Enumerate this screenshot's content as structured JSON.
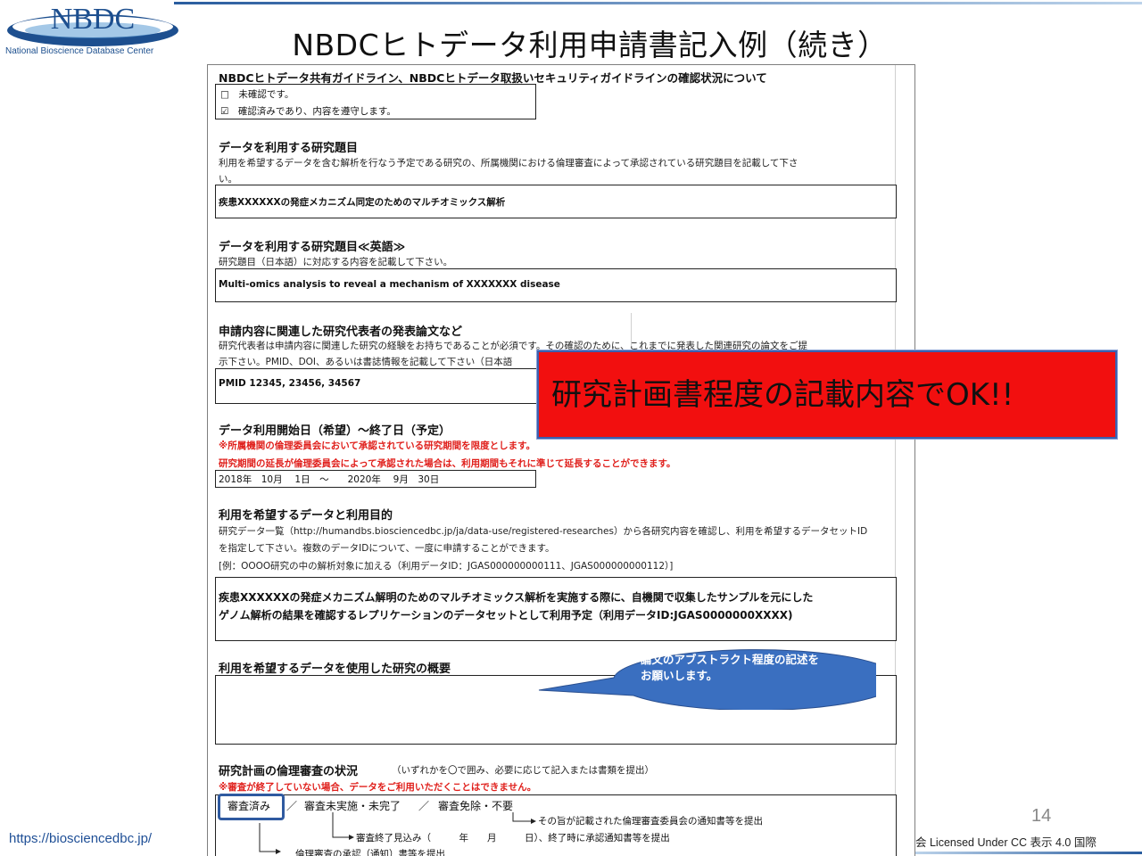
{
  "logo": {
    "text": "NBDC",
    "subtitle": "National Bioscience Database Center"
  },
  "slide": {
    "title": "NBDCヒトデータ利用申請書記入例（続き）",
    "page_number": "14",
    "url": "https://biosciencedbc.jp/",
    "license": "会 Licensed Under CC 表示 4.0 国際"
  },
  "form": {
    "guideline": {
      "heading": "NBDCヒトデータ共有ガイドライン、NBDCヒトデータ取扱いセキュリティガイドラインの確認状況について",
      "opt_unchecked": "□　未確認です。",
      "opt_checked": "☑　確認済みであり、内容を遵守します。"
    },
    "title_jp": {
      "heading": "データを利用する研究題目",
      "desc_line1": "利用を希望するデータを含む解析を行なう予定である研究の、所属機関における倫理審査によって承認されている研究題目を記載して下さ",
      "desc_line2": "い。",
      "value": "疾患XXXXXXの発症メカニズム同定のためのマルチオミックス解析"
    },
    "title_en": {
      "heading": "データを利用する研究題目≪英語≫",
      "desc": "研究題目（日本語）に対応する内容を記載して下さい。",
      "value": "Multi-omics analysis to reveal a mechanism of XXXXXXX disease"
    },
    "papers": {
      "heading": "申請内容に関連した研究代表者の発表論文など",
      "desc_line1": "研究代表者は申請内容に関連した研究の経験をお持ちであることが必須です。その確認のために、これまでに発表した関連研究の論文をご提",
      "desc_line2": "示下さい。PMID、DOI、あるいは書誌情報を記載して下さい（日本語",
      "value": "PMID 12345, 23456, 34567"
    },
    "period": {
      "heading": "データ利用開始日（希望）～終了日（予定）",
      "note1": "※所属機関の倫理委員会において承認されている研究期間を限度とします。",
      "note2": "研究期間の延長が倫理委員会によって承認された場合は、利用期間もそれに準じて延長することができます。",
      "value": "2018年　10月　 1日　～　　2020年　 9月　30日"
    },
    "data_purpose": {
      "heading": "利用を希望するデータと利用目的",
      "desc_line1": "研究データ一覧（http://humandbs.biosciencedbc.jp/ja/data-use/registered-researches）から各研究内容を確認し、利用を希望するデータセットID",
      "desc_line2": "を指定して下さい。複数のデータIDについて、一度に申請することができます。",
      "example": "[例：OOOO研究の中の解析対象に加える（利用データID：JGAS000000000111、JGAS000000000112）]",
      "value_line1": "疾患XXXXXXの発症メカニズム解明のためのマルチオミックス解析を実施する際に、自機関で収集したサンプルを元にした",
      "value_line2": "ゲノム解析の結果を確認するレプリケーションのデータセットとして利用予定（利用データID:JGAS0000000XXXX)"
    },
    "summary": {
      "heading": "利用を希望するデータを使用した研究の概要"
    },
    "ethics": {
      "heading": "研究計画の倫理審査の状況",
      "heading_note": "（いずれかを〇で囲み、必要に応じて記入または書類を提出）",
      "red_note": "※審査が終了していない場合、データをご利用いただくことはできません。",
      "option1": "審査済み",
      "sep1": "／",
      "option2": "審査未実施・未完了",
      "sep2": "／",
      "option3": "審査免除・不要",
      "branch_exempt": "その旨が記載された倫理審査委員会の通知書等を提出",
      "branch_pending": "審査終了見込み（　　　年　　月　　　日）、終了時に承認通知書等を提出",
      "branch_done": "倫理審査の承認（通知）書等を提出"
    }
  },
  "callout_red": {
    "text": "研究計画書程度の記載内容でOK!!"
  },
  "callout_bubble": {
    "line1": "論文のアブストラクト程度の記述を",
    "line2": "お願いします。"
  }
}
